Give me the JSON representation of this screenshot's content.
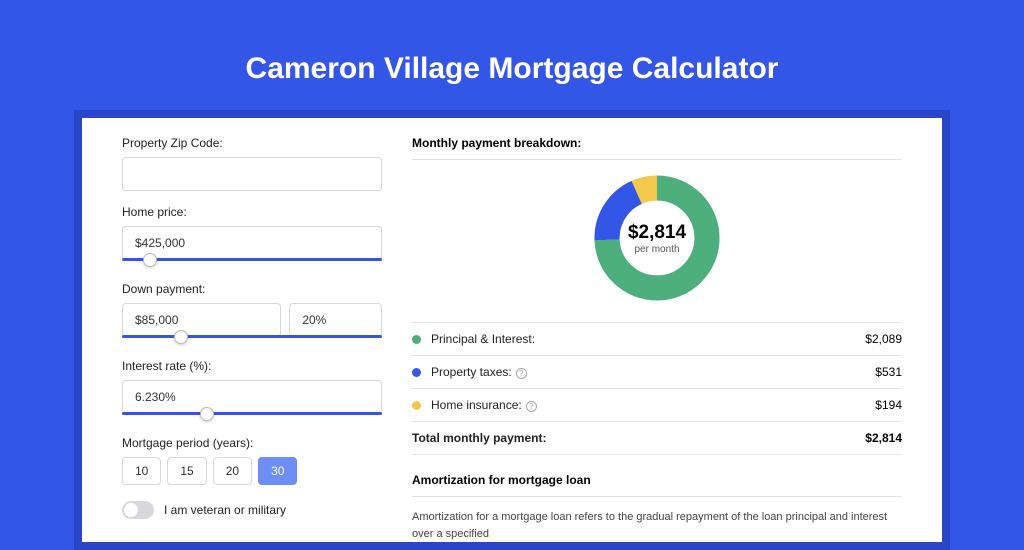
{
  "title": "Cameron Village Mortgage Calculator",
  "form": {
    "zip_label": "Property Zip Code:",
    "zip_value": "",
    "price_label": "Home price:",
    "price_value": "$425,000",
    "down_label": "Down payment:",
    "down_value": "$85,000",
    "down_pct": "20%",
    "rate_label": "Interest rate (%):",
    "rate_value": "6.230%",
    "period_label": "Mortgage period (years):",
    "periods": [
      "10",
      "15",
      "20",
      "30"
    ],
    "period_selected": "30",
    "veteran_label": "I am veteran or military"
  },
  "breakdown": {
    "header": "Monthly payment breakdown:",
    "center_value": "$2,814",
    "center_sub": "per month",
    "rows": [
      {
        "label": "Principal & Interest:",
        "value": "$2,089",
        "color": "#4caf7d",
        "info": false
      },
      {
        "label": "Property taxes:",
        "value": "$531",
        "color": "#3456e6",
        "info": true
      },
      {
        "label": "Home insurance:",
        "value": "$194",
        "color": "#f2c94c",
        "info": true
      }
    ],
    "total_label": "Total monthly payment:",
    "total_value": "$2,814"
  },
  "amort": {
    "header": "Amortization for mortgage loan",
    "body": "Amortization for a mortgage loan refers to the gradual repayment of the loan principal and interest over a specified"
  },
  "chart_data": {
    "type": "pie",
    "title": "Monthly payment breakdown",
    "categories": [
      "Principal & Interest",
      "Property taxes",
      "Home insurance"
    ],
    "values": [
      2089,
      531,
      194
    ],
    "colors": [
      "#4caf7d",
      "#3456e6",
      "#f2c94c"
    ],
    "total": 2814
  }
}
